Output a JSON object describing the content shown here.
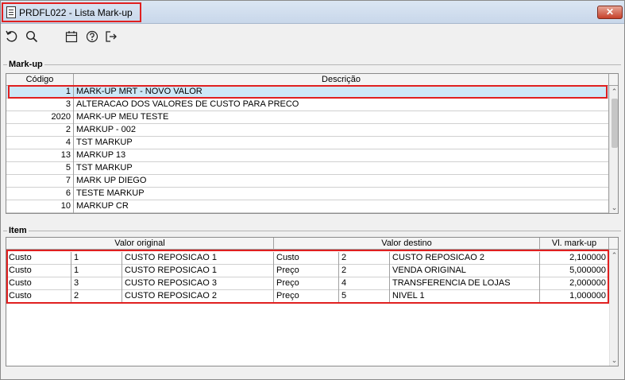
{
  "window": {
    "title": "PRDFL022 - Lista Mark-up",
    "close_label": "✕"
  },
  "toolbar": {
    "icons": [
      "refresh-icon",
      "search-icon",
      "calendar-icon",
      "help-icon",
      "exit-icon"
    ]
  },
  "markup": {
    "group_title": "Mark-up",
    "headers": {
      "codigo": "Código",
      "descricao": "Descrição"
    },
    "rows": [
      {
        "codigo": "1",
        "descricao": "MARK-UP MRT - NOVO VALOR"
      },
      {
        "codigo": "3",
        "descricao": "ALTERACAO DOS VALORES DE CUSTO PARA PRECO"
      },
      {
        "codigo": "2020",
        "descricao": "MARK-UP MEU TESTE"
      },
      {
        "codigo": "2",
        "descricao": "MARKUP - 002"
      },
      {
        "codigo": "4",
        "descricao": "TST MARKUP"
      },
      {
        "codigo": "13",
        "descricao": "MARKUP 13"
      },
      {
        "codigo": "5",
        "descricao": "TST MARKUP"
      },
      {
        "codigo": "7",
        "descricao": "MARK UP DIEGO"
      },
      {
        "codigo": "6",
        "descricao": "TESTE MARKUP"
      },
      {
        "codigo": "10",
        "descricao": "MARKUP CR"
      }
    ]
  },
  "item": {
    "group_title": "Item",
    "headers": {
      "valor_original": "Valor original",
      "valor_destino": "Valor destino",
      "vl_markup": "Vl. mark-up"
    },
    "rows": [
      {
        "orig_tipo": "Custo",
        "orig_cod": "1",
        "orig_desc": "CUSTO REPOSICAO 1",
        "dest_tipo": "Custo",
        "dest_cod": "2",
        "dest_desc": "CUSTO REPOSICAO 2",
        "vl": "2,100000"
      },
      {
        "orig_tipo": "Custo",
        "orig_cod": "1",
        "orig_desc": "CUSTO REPOSICAO 1",
        "dest_tipo": "Preço",
        "dest_cod": "2",
        "dest_desc": "VENDA ORIGINAL",
        "vl": "5,000000"
      },
      {
        "orig_tipo": "Custo",
        "orig_cod": "3",
        "orig_desc": "CUSTO REPOSICAO 3",
        "dest_tipo": "Preço",
        "dest_cod": "4",
        "dest_desc": "TRANSFERENCIA DE LOJAS",
        "vl": "2,000000"
      },
      {
        "orig_tipo": "Custo",
        "orig_cod": "2",
        "orig_desc": "CUSTO REPOSICAO 2",
        "dest_tipo": "Preço",
        "dest_cod": "5",
        "dest_desc": "NIVEL 1",
        "vl": "1,000000"
      }
    ]
  }
}
